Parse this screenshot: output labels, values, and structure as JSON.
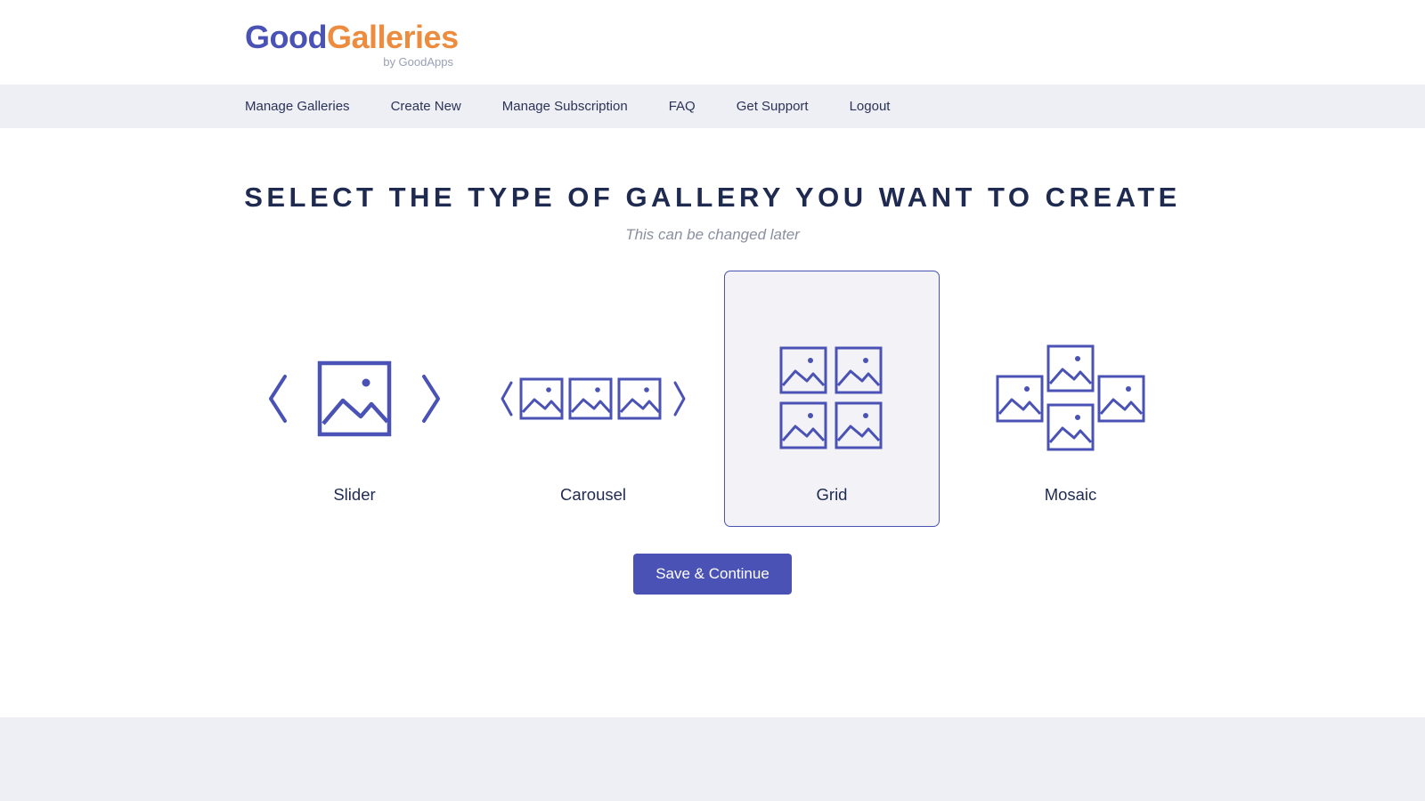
{
  "logo": {
    "part1": "Good",
    "part2": "Galleries",
    "subtitle": "by GoodApps"
  },
  "nav": {
    "items": [
      {
        "label": "Manage Galleries"
      },
      {
        "label": "Create New"
      },
      {
        "label": "Manage Subscription"
      },
      {
        "label": "FAQ"
      },
      {
        "label": "Get Support"
      },
      {
        "label": "Logout"
      }
    ]
  },
  "main": {
    "title": "Select the type of gallery you want to create",
    "subtitle": "This can be changed later",
    "options": [
      {
        "label": "Slider",
        "selected": false
      },
      {
        "label": "Carousel",
        "selected": false
      },
      {
        "label": "Grid",
        "selected": true
      },
      {
        "label": "Mosaic",
        "selected": false
      }
    ],
    "save_button": "Save & Continue"
  },
  "colors": {
    "primary": "#4a53b5",
    "accent": "#ed8c3e",
    "dark_text": "#1f2a50",
    "muted": "#8a8f9f",
    "nav_bg": "#eeeef5"
  }
}
